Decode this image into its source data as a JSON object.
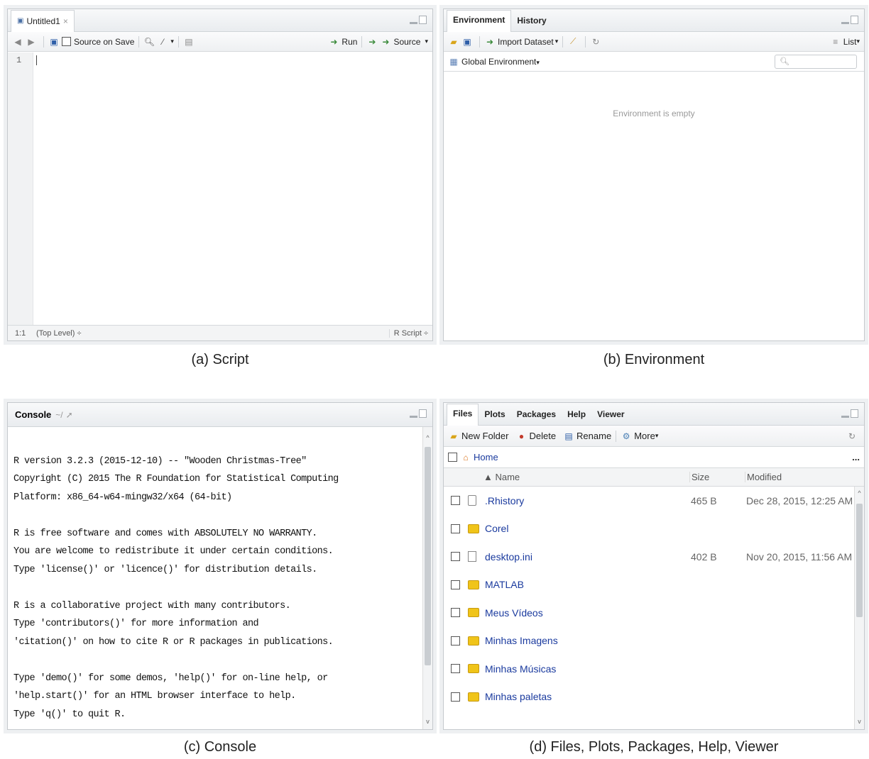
{
  "script": {
    "tab_title": "Untitled1",
    "tab_close": "×",
    "source_on_save": "Source on Save",
    "run": "Run",
    "source": "Source",
    "line_number": "1",
    "status_position": "1:1",
    "status_scope": "(Top Level) ÷",
    "status_type": "R Script ÷"
  },
  "environment": {
    "tabs": [
      "Environment",
      "History"
    ],
    "import_dataset": "Import Dataset",
    "view_mode": "List",
    "global_env": "Global Environment",
    "empty_message": "Environment is empty",
    "search_placeholder": ""
  },
  "console": {
    "title": "Console",
    "path": "~/",
    "lines": [
      "",
      "R version 3.2.3 (2015-12-10) -- \"Wooden Christmas-Tree\"",
      "Copyright (C) 2015 The R Foundation for Statistical Computing",
      "Platform: x86_64-w64-mingw32/x64 (64-bit)",
      "",
      "R is free software and comes with ABSOLUTELY NO WARRANTY.",
      "You are welcome to redistribute it under certain conditions.",
      "Type 'license()' or 'licence()' for distribution details.",
      "",
      "R is a collaborative project with many contributors.",
      "Type 'contributors()' for more information and",
      "'citation()' on how to cite R or R packages in publications.",
      "",
      "Type 'demo()' for some demos, 'help()' for on-line help, or",
      "'help.start()' for an HTML browser interface to help.",
      "Type 'q()' to quit R."
    ]
  },
  "files": {
    "tabs": [
      "Files",
      "Plots",
      "Packages",
      "Help",
      "Viewer"
    ],
    "new_folder": "New Folder",
    "delete": "Delete",
    "rename": "Rename",
    "more": "More",
    "breadcrumb": "Home",
    "ellipsis": "...",
    "columns": {
      "name": "▲ Name",
      "size": "Size",
      "modified": "Modified"
    },
    "rows": [
      {
        "name": ".Rhistory",
        "size": "465 B",
        "modified": "Dec 28, 2015, 12:25 AM",
        "kind": "r"
      },
      {
        "name": "Corel",
        "size": "",
        "modified": "",
        "kind": "folder"
      },
      {
        "name": "desktop.ini",
        "size": "402 B",
        "modified": "Nov 20, 2015, 11:56 AM",
        "kind": "file"
      },
      {
        "name": "MATLAB",
        "size": "",
        "modified": "",
        "kind": "folder"
      },
      {
        "name": "Meus Vídeos",
        "size": "",
        "modified": "",
        "kind": "folder"
      },
      {
        "name": "Minhas Imagens",
        "size": "",
        "modified": "",
        "kind": "folder"
      },
      {
        "name": "Minhas Músicas",
        "size": "",
        "modified": "",
        "kind": "folder"
      },
      {
        "name": "Minhas paletas",
        "size": "",
        "modified": "",
        "kind": "folder"
      }
    ]
  },
  "captions": {
    "a": "(a) Script",
    "b": "(b) Environment",
    "c": "(c) Console",
    "d": "(d) Files, Plots, Packages, Help, Viewer"
  },
  "colors": {
    "link": "#1a3a9e",
    "folder": "#f0c419",
    "border": "#c5c9cd"
  }
}
